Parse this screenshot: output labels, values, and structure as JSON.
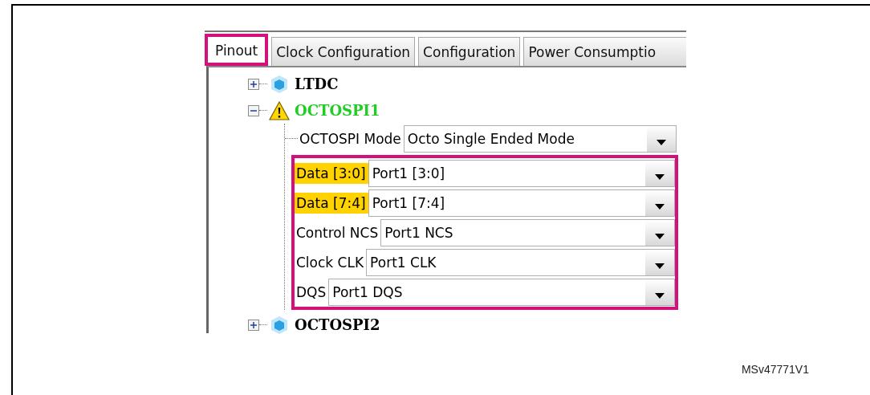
{
  "tabs": [
    {
      "label": "Pinout",
      "selected": true,
      "highlighted": true
    },
    {
      "label": "Clock Configuration",
      "selected": false,
      "highlighted": false
    },
    {
      "label": "Configuration",
      "selected": false,
      "highlighted": false
    },
    {
      "label": "Power Consumptio",
      "selected": false,
      "highlighted": false
    }
  ],
  "tree": [
    {
      "label": "LTDC",
      "kind": "cube",
      "color": "#000000",
      "expanded": false
    },
    {
      "label": "OCTOSPI1",
      "kind": "warning",
      "color": "#22cc22",
      "expanded": true,
      "parameter_groups": [
        {
          "highlighted": false,
          "parameters": [
            {
              "label": "OCTOSPI Mode",
              "value": "Octo Single Ended Mode",
              "warning": false
            }
          ]
        },
        {
          "highlighted": true,
          "parameters": [
            {
              "label": "Data [3:0]",
              "value": "Port1 [3:0]",
              "warning": true
            },
            {
              "label": "Data [7:4]",
              "value": "Port1 [7:4]",
              "warning": true
            },
            {
              "label": "Control NCS",
              "value": "Port1 NCS",
              "warning": false
            },
            {
              "label": "Clock CLK",
              "value": "Port1 CLK",
              "warning": false
            },
            {
              "label": "DQS",
              "value": "Port1 DQS",
              "warning": false
            }
          ]
        }
      ]
    },
    {
      "label": "OCTOSPI2",
      "kind": "cube",
      "color": "#000000",
      "expanded": false
    }
  ],
  "figure_id": "MSv47771V1"
}
